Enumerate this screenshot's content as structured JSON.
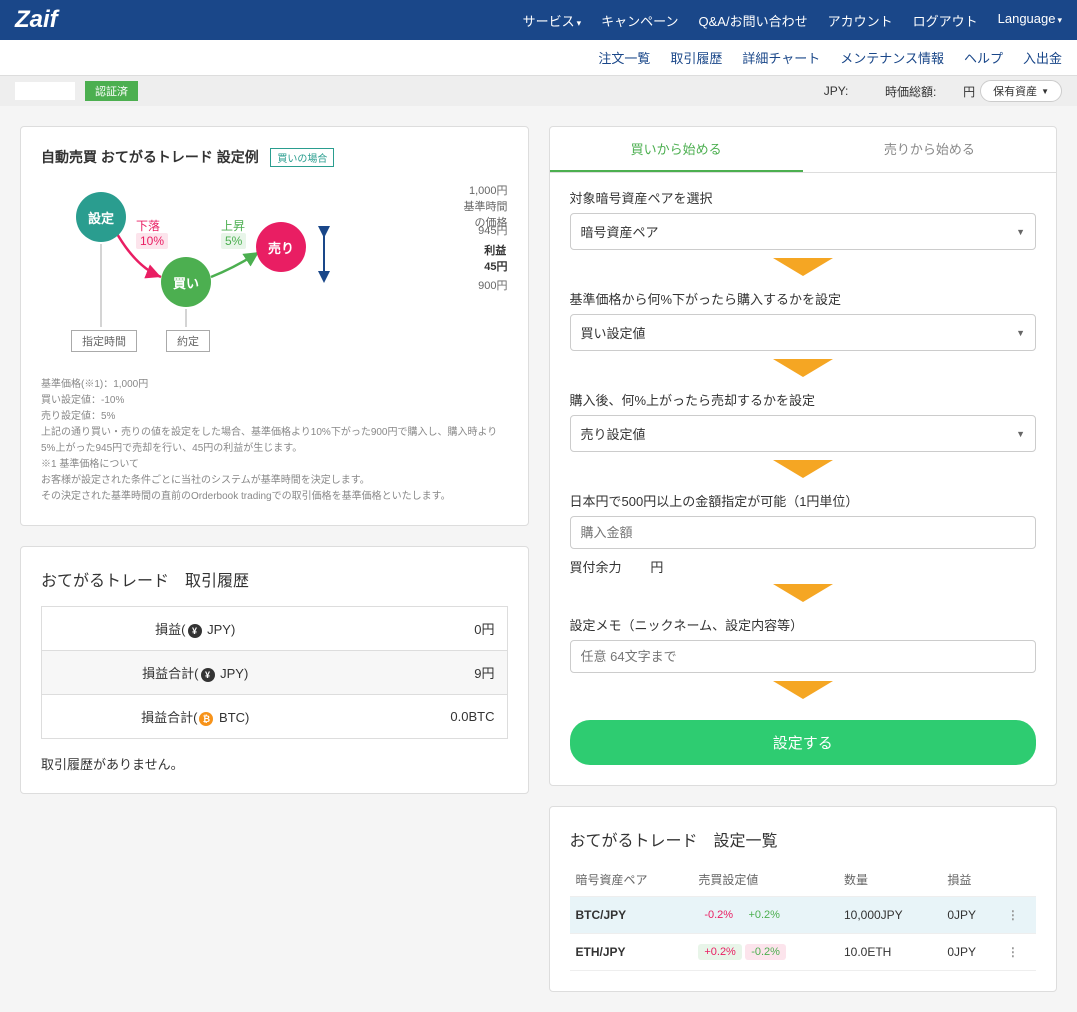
{
  "brand": "Zaif",
  "topnav": {
    "service": "サービス",
    "campaign": "キャンペーン",
    "qa": "Q&A/お問い合わせ",
    "account": "アカウント",
    "logout": "ログアウト",
    "language": "Language"
  },
  "subnav": {
    "orders": "注文一覧",
    "history": "取引履歴",
    "chart": "詳細チャート",
    "maintenance": "メンテナンス情報",
    "help": "ヘルプ",
    "deposit": "入出金"
  },
  "status": {
    "verified": "認証済",
    "jpy_label": "JPY:",
    "marketcap_label": "時価総額:",
    "marketcap_unit": "円",
    "holdings_btn": "保有資産"
  },
  "diagram": {
    "title": "自動売買 おてがるトレード 設定例",
    "tag": "買いの場合",
    "settings": "設定",
    "buy": "買い",
    "sell": "売り",
    "down_label": "下落",
    "down_pct": "10%",
    "up_label": "上昇",
    "up_pct": "5%",
    "price_top": "1,000円",
    "price_top_sub": "基準時間\nの価格",
    "price_945": "945円",
    "profit_label": "利益\n45円",
    "price_900": "900円",
    "time_label": "指定時間",
    "contract_label": "約定"
  },
  "notes": {
    "l1": "基準価格(※1)：1,000円",
    "l2": "買い設定値：-10%",
    "l3": "売り設定値：5%",
    "l4": "上記の通り買い・売りの値を設定をした場合、基準価格より10%下がった900円で購入し、購入時より5%上がった945円で売却を行い、45円の利益が生じます。",
    "l5": "※1 基準価格について",
    "l6": "お客様が設定された条件ごとに当社のシステムが基準時間を決定します。",
    "l7": "その決定された基準時間の直前のOrderbook tradingでの取引価格を基準価格といたします。"
  },
  "history": {
    "title": "おてがるトレード　取引履歴",
    "row1_label": "損益(",
    "row1_cur": " JPY)",
    "row1_val": "0円",
    "row2_label": "損益合計(",
    "row2_cur": " JPY)",
    "row2_val": "9円",
    "row3_label": "損益合計(",
    "row3_cur": " BTC)",
    "row3_val": "0.0BTC",
    "empty": "取引履歴がありません。"
  },
  "form": {
    "tab_buy": "買いから始める",
    "tab_sell": "売りから始める",
    "pair_label": "対象暗号資産ペアを選択",
    "pair_placeholder": "暗号資産ペア",
    "buy_label": "基準価格から何%下がったら購入するかを設定",
    "buy_placeholder": "買い設定値",
    "sell_label": "購入後、何%上がったら売却するかを設定",
    "sell_placeholder": "売り設定値",
    "amount_label": "日本円で500円以上の金額指定が可能（1円単位）",
    "amount_placeholder": "購入金額",
    "balance_label": "買付余力",
    "balance_unit": "円",
    "memo_label": "設定メモ（ニックネーム、設定内容等）",
    "memo_placeholder": "任意 64文字まで",
    "submit": "設定する"
  },
  "settings_list": {
    "title": "おてがるトレード　設定一覧",
    "col_pair": "暗号資産ペア",
    "col_trade": "売買設定値",
    "col_qty": "数量",
    "col_pl": "損益",
    "rows": [
      {
        "pair": "BTC/JPY",
        "buy": "-0.2%",
        "sell": "+0.2%",
        "qty": "10,000JPY",
        "pl": "0JPY",
        "highlight": true,
        "buy_bg": "",
        "sell_bg": ""
      },
      {
        "pair": "ETH/JPY",
        "buy": "+0.2%",
        "sell": "-0.2%",
        "qty": "10.0ETH",
        "pl": "0JPY",
        "highlight": false,
        "buy_bg": "bg-green",
        "sell_bg": "bg-pink"
      }
    ]
  }
}
